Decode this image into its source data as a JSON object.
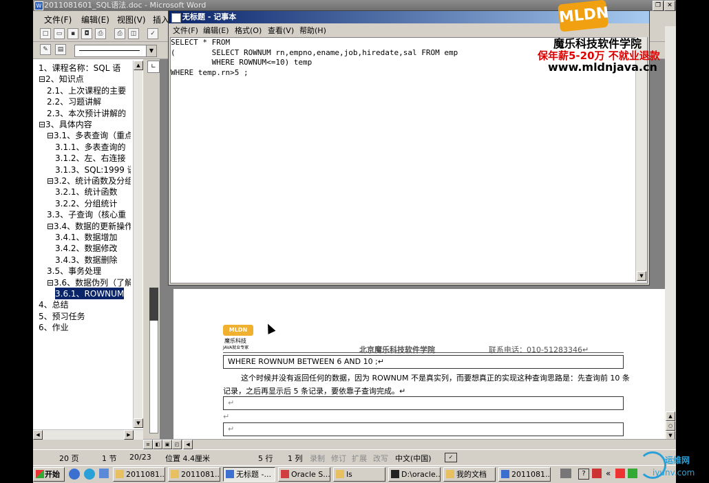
{
  "word": {
    "title": "2011081601_SQL语法.doc - Microsoft Word",
    "menu": [
      "文件(F)",
      "编辑(E)",
      "视图(V)",
      "插入"
    ],
    "docmap_items": [
      "1、课程名称：SQL 语",
      "⊟2、知识点",
      "2.1、上次课程的主要",
      "2.2、习题讲解",
      "2.3、本次预计讲解的",
      "⊟3、具体内容",
      "⊟3.1、多表查询（重点",
      "3.1.1、多表查询的",
      "3.1.2、左、右连接",
      "3.1.3、SQL:1999 语",
      "⊟3.2、统计函数及分组",
      "3.2.1、统计函数",
      "3.2.2、分组统计",
      "3.3、子查询（核心重",
      "⊟3.4、数据的更新操作",
      "3.4.1、数据增加",
      "3.4.2、数据修改",
      "3.4.3、数据删除",
      "3.5、事务处理",
      "⊟3.6、数据伪列（了解",
      "3.6.1、ROWNUM",
      "4、总结",
      "5、预习任务",
      "6、作业"
    ],
    "status": {
      "page": "20 页",
      "section": "1 节",
      "pages": "20/23",
      "position": "位置 4.4厘米",
      "line": "5 行",
      "col": "1 列",
      "rec": "录制",
      "trk": "修订",
      "ext": "扩展",
      "ovr": "改写",
      "lang": "中文(中国)"
    },
    "page": {
      "header_org": "北京魔乐科技软件学院",
      "header_phone": "联系电话：010-51283346↵",
      "code_line": "WHERE ROWNUM BETWEEN 6 AND 10 ;↵",
      "para_line1": "这个时候并没有返回任何的数据，因为 ROWNUM 不是真实列，而要想真正的实现这种查询思路是：先查询前 10 条",
      "para_line2": "记录，之后再显示后 5 条记录，要依靠子查询完成。↵",
      "empty_mark": "↵",
      "logo_text": "魔乐科技",
      "logo_sub": "JAVA就业专家"
    }
  },
  "notepad": {
    "title": "无标题 - 记事本",
    "menu": [
      "文件(F)",
      "编辑(E)",
      "格式(O)",
      "查看(V)",
      "帮助(H)"
    ],
    "content": "SELECT * FROM\n(        SELECT ROWNUM rn,empno,ename,job,hiredate,sal FROM emp\n         WHERE ROWNUM<=10) temp\nWHERE temp.rn>5 ;"
  },
  "brand": {
    "logo": "MLDN",
    "name": "魔乐科技软件学院",
    "slogan": "保年薪5-20万 不就业退款",
    "url": "www.mldnjava.cn"
  },
  "taskbar": {
    "start": "开始",
    "buttons": [
      "2011081...",
      "2011081...",
      "无标题 -...",
      "Oracle S...",
      "ls",
      "D:\\oracle...",
      "我的文档",
      "2011081..."
    ],
    "tray": "«"
  },
  "watermark": {
    "text1": "运维网",
    "text2": "iyunv.com"
  },
  "colors": {
    "accent_title": "#0a246a",
    "selection": "#0a246a",
    "brand_red": "#dd0000",
    "brand_orange": "#f0a010"
  }
}
